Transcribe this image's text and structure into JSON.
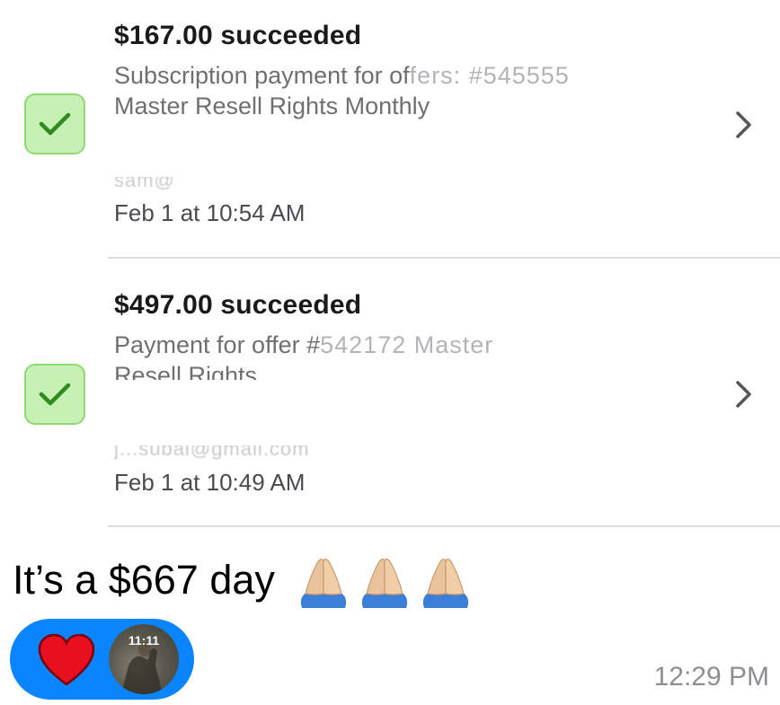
{
  "payments": [
    {
      "amount": "$167.00 succeeded",
      "desc_line1_visible": "Subscription payment for of",
      "desc_line1_obscured": "fers: #545555",
      "desc_line2_visible": "Master Resell Rights Monthly",
      "desc_line2_obscured": "",
      "email_obscured": "sam@",
      "date": "Feb 1 at 10:54 AM",
      "status_icon": "checkmark-icon",
      "chevron_icon": "chevron-right-icon"
    },
    {
      "amount": "$497.00 succeeded",
      "desc_line1_visible": "Payment for offer #",
      "desc_line1_obscured": "542172 Master",
      "desc_line2_visible": "Resell Rights",
      "desc_line2_obscured": "",
      "email_obscured": "j...subai@gmail.com",
      "date": "Feb 1 at 10:49 AM",
      "status_icon": "checkmark-icon",
      "chevron_icon": "chevron-right-icon"
    }
  ],
  "message": {
    "text": "It’s a $667 day",
    "emoji": [
      "folded-hands-icon",
      "folded-hands-icon",
      "folded-hands-icon"
    ],
    "timestamp": "12:29 PM"
  },
  "reaction": {
    "icon": "red-heart-icon",
    "avatar_time": "11:11"
  },
  "colors": {
    "accent_blue": "#0a84ff",
    "check_bg": "#c7f1b4",
    "check_border": "#8fd873",
    "check_mark": "#2f8a1f",
    "heart_red": "#e8101f",
    "secondary_text": "#6f6f73"
  }
}
